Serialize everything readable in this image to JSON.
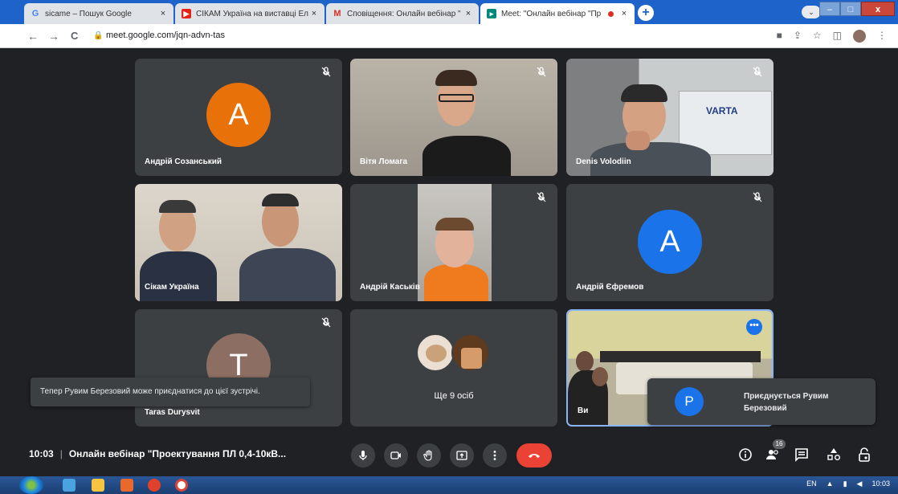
{
  "browser": {
    "tabs": [
      {
        "title": "sicame – Пошук Google",
        "favicon": "google-G-icon",
        "close": "×"
      },
      {
        "title": "СІКАМ Україна на виставці Еле",
        "favicon": "youtube-icon",
        "close": "×"
      },
      {
        "title": "Сповіщення: Онлайн вебінар \"",
        "favicon": "gmail-icon",
        "close": "×"
      },
      {
        "title": "Meet: \"Онлайн вебінар \"Пр",
        "favicon": "meet-icon",
        "close": "×"
      }
    ],
    "new_tab": "+",
    "profile_chip": "⌄",
    "window_buttons": {
      "minimize": "–",
      "maximize": "□",
      "close": "x"
    },
    "nav": {
      "back": "←",
      "forward": "→",
      "reload": "C",
      "lock": "🔒"
    },
    "url": "meet.google.com/jqn-advn-tas",
    "addr_icons": [
      "■",
      "⇪",
      "☆",
      "◫"
    ]
  },
  "tiles": [
    {
      "name": "Андрій Созанський",
      "type": "avatar",
      "letter": "A",
      "color": "#e8710a",
      "muted": true
    },
    {
      "name": "Вітя Ломага",
      "type": "video",
      "muted": true
    },
    {
      "name": "Denis Volodiin",
      "type": "video",
      "muted": true,
      "sign": "VARTA"
    },
    {
      "name": "Сікам Україна",
      "type": "video",
      "muted": false
    },
    {
      "name": "Андрій Каськів",
      "type": "video",
      "muted": true
    },
    {
      "name": "Андрій Єфремов",
      "type": "avatar",
      "letter": "A",
      "color": "#1a73e8",
      "muted": true
    },
    {
      "name": "Taras Durysvit",
      "type": "avatar",
      "letter": "T",
      "color": "#8d6e63",
      "muted": true
    },
    {
      "name": "",
      "type": "others",
      "label": "Ще 9 осіб"
    },
    {
      "name": "Ви",
      "type": "video",
      "muted": false,
      "more": "•••"
    }
  ],
  "toast_left": "Тепер Рувим Березовий може приєднатися до цієї зустрічі.",
  "toast_right": {
    "letter": "P",
    "text": "Приєднується Рувим Березовий"
  },
  "bottom": {
    "time": "10:03",
    "separator": "|",
    "meeting_title": "Онлайн вебінар \"Проектування ПЛ 0,4-10кВ...",
    "participants_count": "16"
  },
  "taskbar": {
    "lang": "EN",
    "tray_arrow": "▲",
    "clock": "10:03"
  }
}
